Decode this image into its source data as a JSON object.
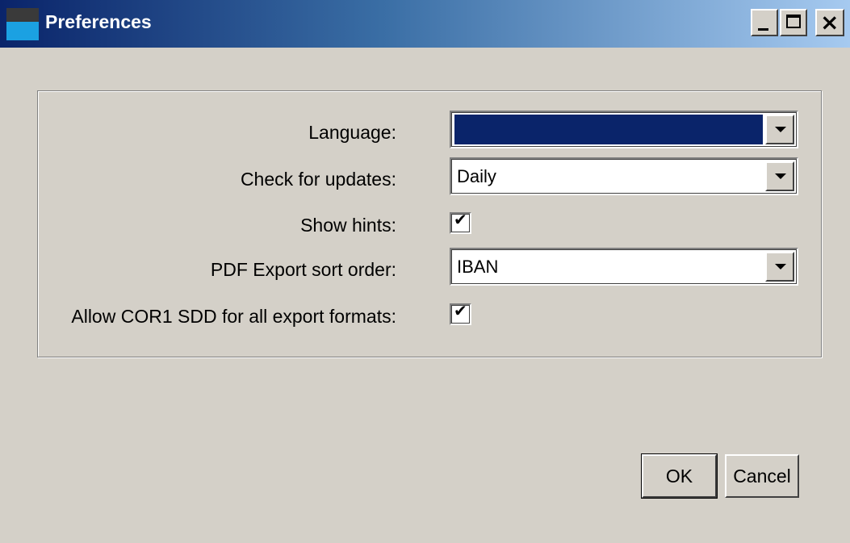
{
  "window": {
    "title": "Preferences",
    "controls": {
      "minimize_icon": "minimize-icon",
      "maximize_icon": "maximize-icon",
      "close_icon": "close-icon"
    }
  },
  "colors": {
    "titlebar_start": "#0a246a",
    "titlebar_end": "#a6caf0",
    "selection": "#0a246a",
    "background": "#d4d0c8"
  },
  "form": {
    "language": {
      "label": "Language:",
      "value": ""
    },
    "updates": {
      "label": "Check for updates:",
      "value": "Daily"
    },
    "hints": {
      "label": "Show hints:",
      "checked": true,
      "mark": "✔"
    },
    "pdf_sort": {
      "label": "PDF Export sort order:",
      "value": "IBAN"
    },
    "cor1": {
      "label": "Allow COR1 SDD for all export formats:",
      "checked": true,
      "mark": "✔"
    }
  },
  "buttons": {
    "ok": "OK",
    "cancel": "Cancel"
  }
}
